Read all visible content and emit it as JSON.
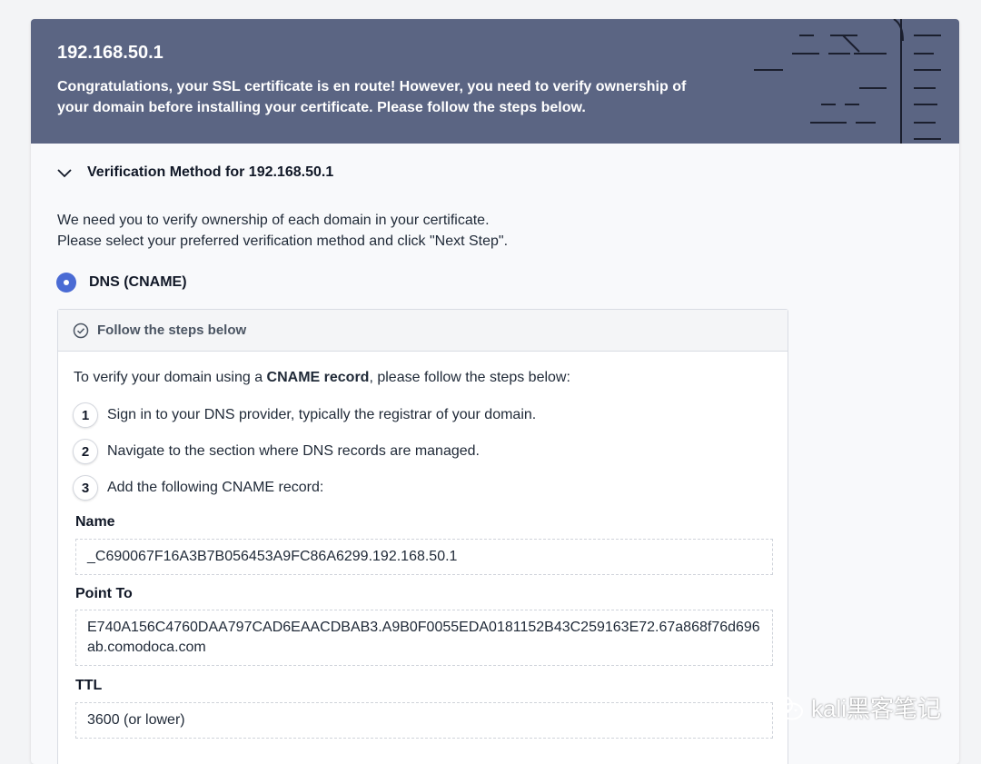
{
  "header": {
    "domain": "192.168.50.1",
    "message": "Congratulations, your SSL certificate is en route! However, you need to verify ownership of your domain before installing your certificate. Please follow the steps below."
  },
  "section": {
    "title": "Verification Method for 192.168.50.1",
    "intro_line1": "We need you to verify ownership of each domain in your certificate.",
    "intro_line2": "Please select your preferred verification method and click \"Next Step\"."
  },
  "method": {
    "selected_label": "DNS (CNAME)"
  },
  "steps_panel": {
    "header": "Follow the steps below",
    "lead_prefix": "To verify your domain using a ",
    "lead_bold": "CNAME record",
    "lead_suffix": ", please follow the steps below:",
    "steps": [
      {
        "num": "1",
        "text": "Sign in to your DNS provider, typically the registrar of your domain."
      },
      {
        "num": "2",
        "text": "Navigate to the section where DNS records are managed."
      },
      {
        "num": "3",
        "text": "Add the following CNAME record:"
      }
    ],
    "fields": {
      "name_label": "Name",
      "name_value": "_C690067F16A3B7B056453A9FC86A6299.192.168.50.1",
      "point_label": "Point To",
      "point_value": "E740A156C4760DAA797CAD6EAACDBAB3.A9B0F0055EDA0181152B43C259163E72.67a868f76d696ab.comodoca.com",
      "ttl_label": "TTL",
      "ttl_value": "3600 (or lower)"
    }
  },
  "watermark": {
    "text": "kali黑客笔记",
    "icon": "wechat-icon"
  },
  "colors": {
    "header_bg": "#5b6583",
    "radio_selected": "#4a6bd4"
  }
}
